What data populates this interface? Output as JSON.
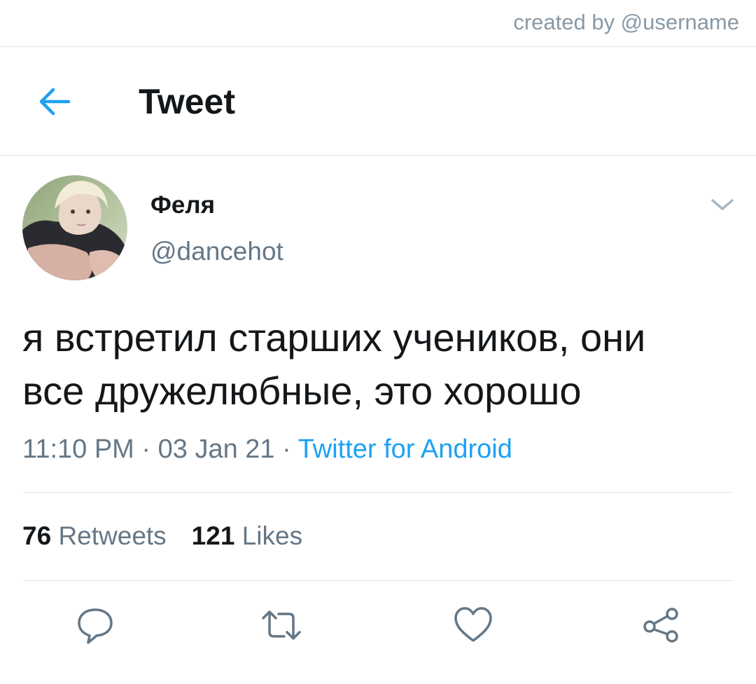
{
  "watermark": "created by @username",
  "header": {
    "title": "Tweet",
    "back_icon": "arrow-left-icon",
    "accent_color": "#1da1f2"
  },
  "author": {
    "display_name": "Феля",
    "handle": "@dancehot"
  },
  "tweet": {
    "text_line1": "я встретил старших учеников, они",
    "text_line2": "все дружелюбные, это хорошо",
    "time": "11:10 PM",
    "separator": " · ",
    "date": "03 Jan 21",
    "source": "Twitter for Android"
  },
  "stats": {
    "retweets_count": "76",
    "retweets_label": "Retweets",
    "likes_count": "121",
    "likes_label": "Likes"
  },
  "actions": [
    {
      "icon": "reply-icon"
    },
    {
      "icon": "retweet-icon"
    },
    {
      "icon": "like-icon"
    },
    {
      "icon": "share-icon"
    }
  ],
  "colors": {
    "text_primary": "#14171a",
    "text_secondary": "#657786",
    "divider": "#e1e8ed",
    "link": "#1da1f2"
  }
}
